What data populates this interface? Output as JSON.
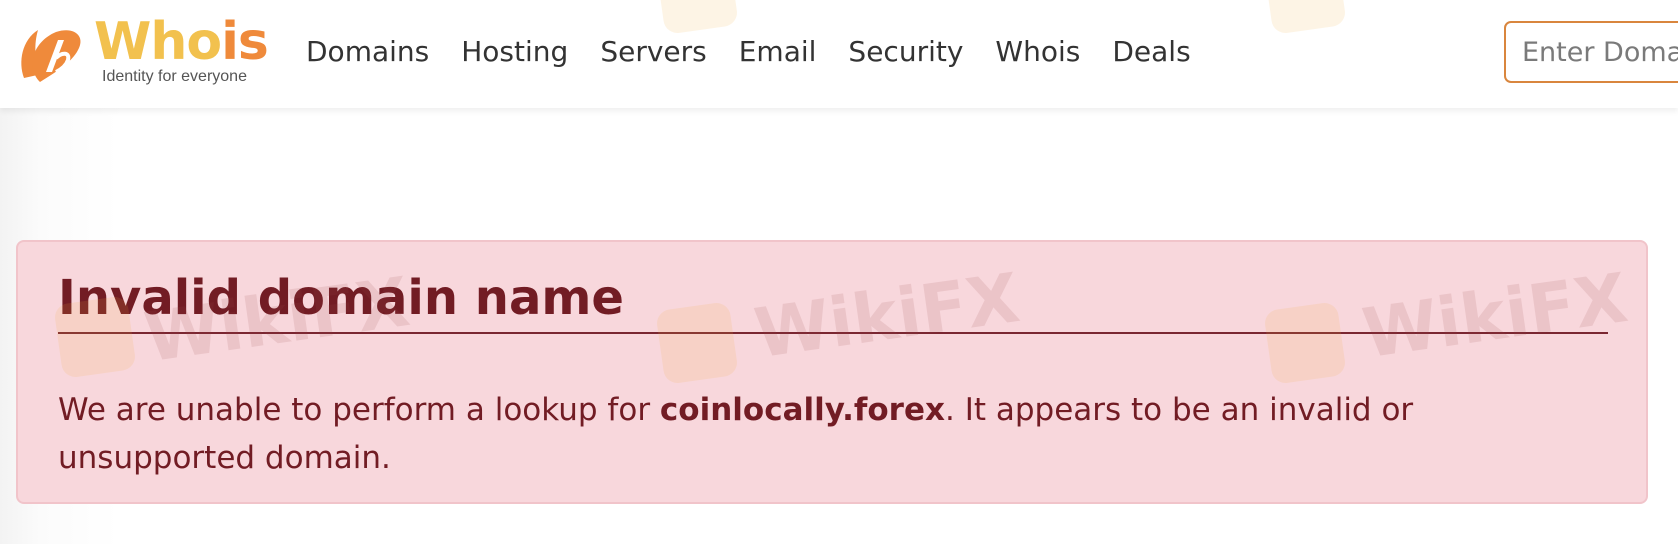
{
  "brand": {
    "name_part1": "Who",
    "name_part2": "is",
    "tagline": "Identity for everyone",
    "colors": {
      "yellow": "#f2c14e",
      "orange": "#ef8a3b"
    }
  },
  "nav": {
    "items": [
      {
        "label": "Domains"
      },
      {
        "label": "Hosting"
      },
      {
        "label": "Servers"
      },
      {
        "label": "Email"
      },
      {
        "label": "Security"
      },
      {
        "label": "Whois"
      },
      {
        "label": "Deals"
      }
    ]
  },
  "search": {
    "placeholder": "Enter Domain",
    "value": ""
  },
  "alert": {
    "heading": "Invalid domain name",
    "message_prefix": "We are unable to perform a lookup for ",
    "domain": "coinlocally.forex",
    "message_suffix": ". It appears to be an invalid or unsupported domain.",
    "colors": {
      "background": "#f8d7dc",
      "text": "#721c24",
      "border": "#f1c4ca"
    }
  },
  "watermark": {
    "text": "WikiFX"
  }
}
